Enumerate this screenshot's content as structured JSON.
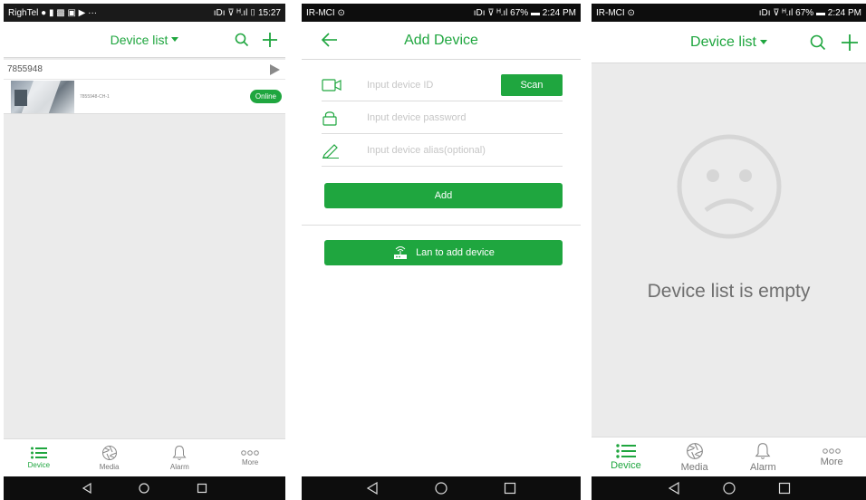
{
  "colors": {
    "accent": "#1fa63f",
    "icon_grey": "#b5b5b5",
    "status_dark": "#0d0d0d"
  },
  "screen1": {
    "status": {
      "left": "RighTel ● ▮ ▩ ▣ ▶ ···",
      "right": "ıDı ⊽ ᴴ.ıl ⌷ 15:27"
    },
    "title": "Device list",
    "device_group": "7855948",
    "device": {
      "channel": "7855948-CH-1",
      "status": "Online"
    },
    "nav": [
      "Device",
      "Media",
      "Alarm",
      "More"
    ]
  },
  "screen2": {
    "status": {
      "left": "IR-MCI ⊙",
      "right": "ıDı ⊽ ᴴ.ıl 67% ▬ 2:24 PM"
    },
    "title": "Add Device",
    "device_id_placeholder": "Input device ID",
    "scan_label": "Scan",
    "password_placeholder": "Input device password",
    "alias_placeholder": "Input device alias(optional)",
    "add_label": "Add",
    "lan_label": "Lan to add device"
  },
  "screen3": {
    "status": {
      "left": "IR-MCI ⊙",
      "right": "ıDı ⊽ ᴴ.ıl 67% ▬ 2:24 PM"
    },
    "title": "Device list",
    "empty_text": "Device list is empty",
    "nav": [
      "Device",
      "Media",
      "Alarm",
      "More"
    ]
  }
}
